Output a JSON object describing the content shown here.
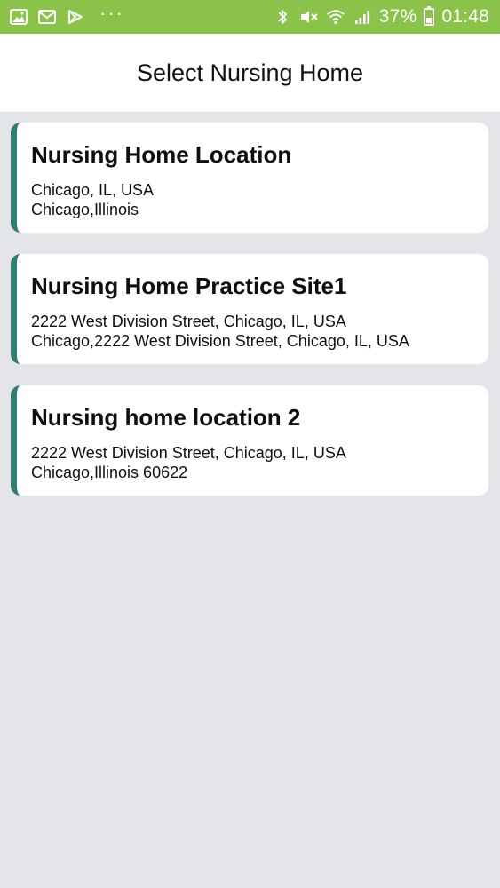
{
  "status_bar": {
    "icons_left": [
      "gallery-icon",
      "mail-icon",
      "play-store-icon",
      "more-icon"
    ],
    "more_text": "···",
    "battery_percent": "37%",
    "time": "01:48",
    "colors": {
      "background": "#8bc34a",
      "foreground": "#ffffff"
    }
  },
  "header": {
    "title": "Select Nursing Home"
  },
  "nursing_homes": [
    {
      "name": "Nursing Home Location",
      "address_line1": "Chicago, IL, USA",
      "address_line2": "Chicago,Illinois"
    },
    {
      "name": "Nursing Home Practice Site1",
      "address_line1": "2222 West Division Street, Chicago, IL, USA",
      "address_line2": "Chicago,2222 West Division Street, Chicago, IL, USA"
    },
    {
      "name": "Nursing home location 2",
      "address_line1": "2222 West Division Street, Chicago, IL, USA",
      "address_line2": "Chicago,Illinois 60622"
    }
  ],
  "colors": {
    "page_background": "#e3e5e8",
    "card_accent": "#2f7f73",
    "card_background": "#ffffff"
  }
}
